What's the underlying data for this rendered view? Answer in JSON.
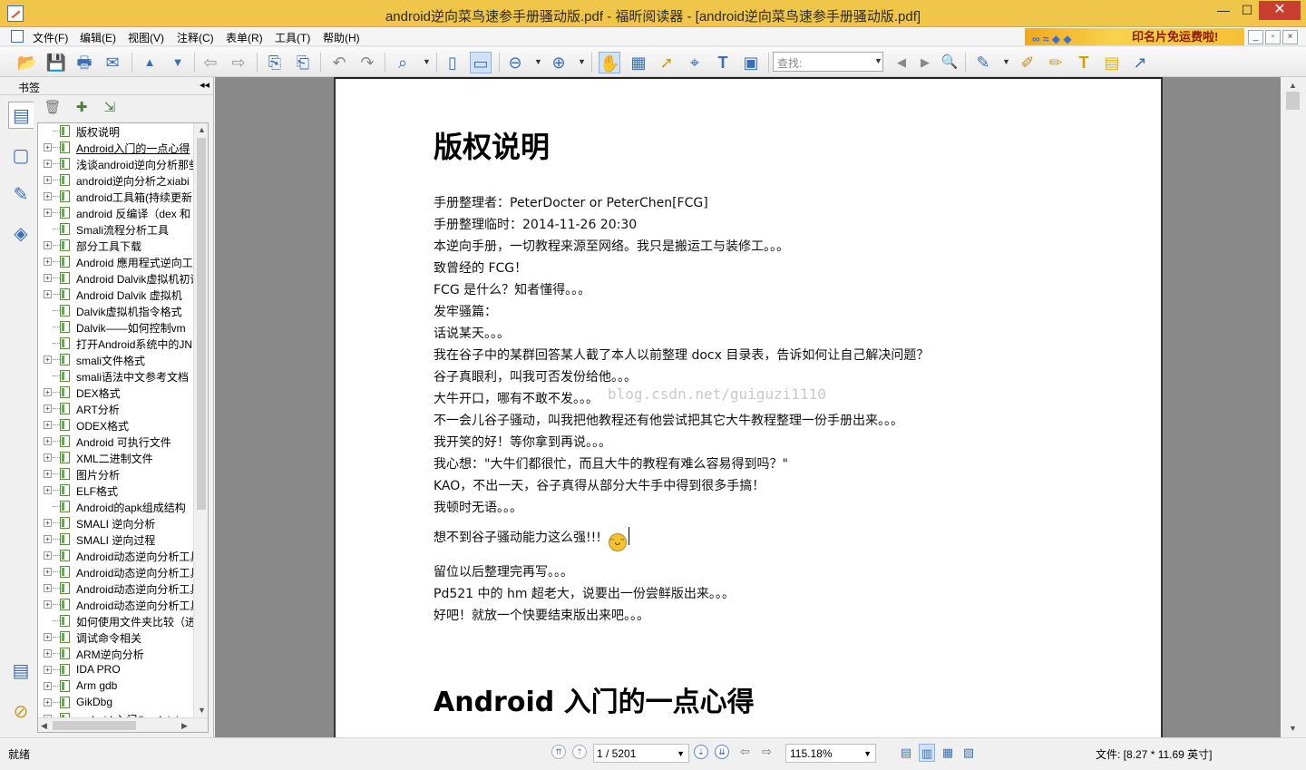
{
  "window": {
    "title": "android逆向菜鸟速参手册骚动版.pdf - 福昕阅读器 - [android逆向菜鸟速参手册骚动版.pdf]",
    "min_glyph": "—",
    "max_glyph": "☐",
    "close_glyph": "✕"
  },
  "menu": {
    "items": [
      "文件(F)",
      "编辑(E)",
      "视图(V)",
      "注释(C)",
      "表单(R)",
      "工具(T)",
      "帮助(H)"
    ],
    "ad_text": "印名片免运费啦!",
    "mdi_min": "_",
    "mdi_restore": "▫",
    "mdi_close": "×"
  },
  "toolbar": {
    "find_placeholder": "查找:",
    "icons": {
      "open": "📂",
      "save": "💾",
      "print": "🖶",
      "email": "✉",
      "nav_up": "▲",
      "nav_down": "▼",
      "back": "⇦",
      "forward": "⇨",
      "extract": "⎘",
      "insert": "⎗",
      "undo": "↶",
      "redo": "↷",
      "zoom": "⌕",
      "fit_page": "▯",
      "fit_width": "▭",
      "zoom_out": "⊖",
      "zoom_in": "⊕",
      "hand": "✋",
      "select_text": "▦",
      "select": "➚",
      "binoculars": "⌖",
      "typewriter": "T",
      "snapshot": "▣",
      "prev_find": "◀",
      "next_find": "▶",
      "search_all": "🔍",
      "comment": "✎",
      "stamp": "✐",
      "highlight": "✏",
      "textbox": "T",
      "note": "▤",
      "arrow": "↗",
      "dropdown": "▼"
    }
  },
  "sidebar": {
    "title": "书签",
    "collapse": "◂◂",
    "tools": {
      "delete": "🗑",
      "add": "✚",
      "properties": "⇲"
    },
    "tabs": {
      "bookmarks": "▤",
      "pages": "▢",
      "annotations": "✎",
      "layers": "◈",
      "comments": "▤",
      "attachments": "⊘"
    },
    "scroll_up": "▲",
    "scroll_down": "▼",
    "scroll_left": "◀",
    "scroll_right": "▶",
    "expander": "+",
    "bookmarks": [
      {
        "label": "版权说明",
        "expandable": false
      },
      {
        "label": "Android入门的一点心得",
        "expandable": true
      },
      {
        "label": "浅谈android逆向分析那些",
        "expandable": true
      },
      {
        "label": "android逆向分析之xiabi",
        "expandable": true
      },
      {
        "label": "android工具箱(持续更新",
        "expandable": true
      },
      {
        "label": "android 反编译（dex 和",
        "expandable": true
      },
      {
        "label": "Smali流程分析工具",
        "expandable": false
      },
      {
        "label": "部分工具下载",
        "expandable": true
      },
      {
        "label": "Android 應用程式逆向工",
        "expandable": true
      },
      {
        "label": "Android Dalvik虚拟机初识",
        "expandable": true
      },
      {
        "label": "Android Dalvik 虚拟机",
        "expandable": true
      },
      {
        "label": "Dalvik虚拟机指令格式",
        "expandable": false
      },
      {
        "label": "Dalvik——如何控制vm",
        "expandable": false
      },
      {
        "label": "打开Android系统中的JNI",
        "expandable": false
      },
      {
        "label": "smali文件格式",
        "expandable": true
      },
      {
        "label": "smali语法中文参考文档",
        "expandable": false
      },
      {
        "label": "DEX格式",
        "expandable": true
      },
      {
        "label": "ART分析",
        "expandable": true
      },
      {
        "label": "ODEX格式",
        "expandable": true
      },
      {
        "label": "Android 可执行文件",
        "expandable": true
      },
      {
        "label": "XML二进制文件",
        "expandable": true
      },
      {
        "label": "图片分析",
        "expandable": true
      },
      {
        "label": "ELF格式",
        "expandable": true
      },
      {
        "label": "Android的apk组成结构",
        "expandable": false
      },
      {
        "label": "SMALI 逆向分析",
        "expandable": true
      },
      {
        "label": "SMALI 逆向过程",
        "expandable": true
      },
      {
        "label": "Android动态逆向分析工具",
        "expandable": true
      },
      {
        "label": "Android动态逆向分析工具",
        "expandable": true
      },
      {
        "label": "Android动态逆向分析工具",
        "expandable": true
      },
      {
        "label": "Android动态逆向分析工具",
        "expandable": true
      },
      {
        "label": "如何使用文件夹比较（进",
        "expandable": false
      },
      {
        "label": "调试命令相关",
        "expandable": true
      },
      {
        "label": "ARM逆向分析",
        "expandable": true
      },
      {
        "label": "IDA PRO",
        "expandable": true
      },
      {
        "label": "Arm gdb",
        "expandable": true
      },
      {
        "label": "GikDbg",
        "expandable": true
      },
      {
        "label": "android 入门(hook injec",
        "expandable": true
      }
    ]
  },
  "document": {
    "heading": "版权说明",
    "lines": [
      "手册整理者：PeterDocter or PeterChen[FCG]",
      "手册整理临时：2014-11-26 20:30",
      "本逆向手册，一切教程来源至网络。我只是搬运工与装修工。。。",
      "致曾经的 FCG！",
      "FCG 是什么？知者懂得。。。",
      "发牢骚篇：",
      "话说某天。。。",
      "我在谷子中的某群回答某人截了本人以前整理 docx 目录表，告诉如何让自己解决问题？",
      "谷子真眼利，叫我可否发份给他。。。",
      "大牛开口，哪有不敢不发。。。",
      "不一会儿谷子骚动，叫我把他教程还有他尝试把其它大牛教程整理一份手册出来。。。",
      "我开笑的好！等你拿到再说。。。",
      "我心想：\"大牛们都很忙，而且大牛的教程有难么容易得到吗？\"",
      "KAO，不出一天，谷子真得从部分大牛手中得到很多手搞！",
      "我顿时无语。。。"
    ],
    "emphasis_line": "想不到谷子骚动能力这么强!!!",
    "smiley": "ᵔᴗᵔ",
    "lines_after": [
      "留位以后整理完再写。。。",
      "Pd521 中的 hm 超老大，说要出一份尝鲜版出来。。。",
      "好吧！就放一个快要结束版出来吧。。。"
    ],
    "watermark": "blog.csdn.net/guiguzi1110",
    "heading2": "Android 入门的一点心得"
  },
  "scrollbar": {
    "up": "▲",
    "down": "▼"
  },
  "status": {
    "text": "就绪",
    "first": "⇈",
    "prev": "⇡",
    "page": "1 / 5201",
    "next": "⇣",
    "last": "⇊",
    "back": "⇦",
    "forward": "⇨",
    "zoom": "115.18%",
    "dropdown": "▼",
    "view_single": "▤",
    "view_continuous": "▥",
    "view_facing": "▦",
    "view_cont_facing": "▧",
    "file_size": "文件: [8.27 * 11.69 英寸]"
  }
}
